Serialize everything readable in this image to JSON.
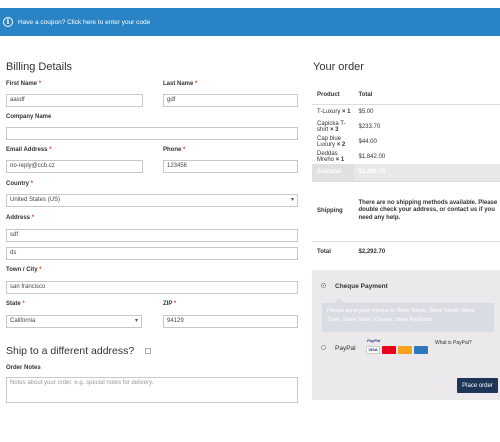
{
  "notice": {
    "icon": "info-icon",
    "text": "Have a coupon? Click here to enter your code"
  },
  "billing": {
    "title": "Billing Details",
    "first_name": {
      "label": "First Name",
      "value": "aasdf"
    },
    "last_name": {
      "label": "Last Name",
      "value": "gdf"
    },
    "company": {
      "label": "Company Name",
      "value": ""
    },
    "email": {
      "label": "Email Address",
      "value": "no-reply@ccb.cz"
    },
    "phone": {
      "label": "Phone",
      "value": "123456"
    },
    "country": {
      "label": "Country",
      "value": "United States (US)"
    },
    "address": {
      "label": "Address",
      "line1": "sdf",
      "line2": "ds"
    },
    "city": {
      "label": "Town / City",
      "value": "san francisco"
    },
    "state": {
      "label": "State",
      "value": "California"
    },
    "zip": {
      "label": "ZIP",
      "value": "94129"
    },
    "required_mark": "*"
  },
  "ship": {
    "title": "Ship to a different address?"
  },
  "notes": {
    "label": "Order Notes",
    "placeholder": "Notes about your order, e.g. special notes for delivery."
  },
  "order": {
    "title": "Your order",
    "head": {
      "product": "Product",
      "total": "Total"
    },
    "items": [
      {
        "name": "T-Luxury",
        "qty": "× 1",
        "total": "$5.00"
      },
      {
        "name": "Capicka T-shirt",
        "qty": "× 3",
        "total": "$233.70"
      },
      {
        "name": "Cap blue Luxury",
        "qty": "× 2",
        "total": "$44.00"
      },
      {
        "name": "Deddas Mreho",
        "qty": "× 1",
        "total": "$1,842.00"
      }
    ],
    "subtotal": {
      "label": "Subtotal",
      "value": "$2,292.70"
    },
    "shipping": {
      "label": "Shipping",
      "value": "There are no shipping methods available. Please double check your address, or contact us if you need any help."
    },
    "total": {
      "label": "Total",
      "value": "$2,292.70"
    }
  },
  "payment": {
    "cheque": {
      "label": "Cheque Payment",
      "description": "Please send your cheque to Store Name, Store Street, Store Town, Store State / County, Store Postcode."
    },
    "paypal": {
      "label": "PayPal",
      "what_is": "What is PayPal?",
      "logo_text": "PayPal"
    },
    "place_order": "Place order"
  },
  "colors": {
    "notice": "#2a83c4",
    "button": "#1d3557",
    "required": "#e2401c",
    "payment_bg": "#ebe9eb"
  }
}
